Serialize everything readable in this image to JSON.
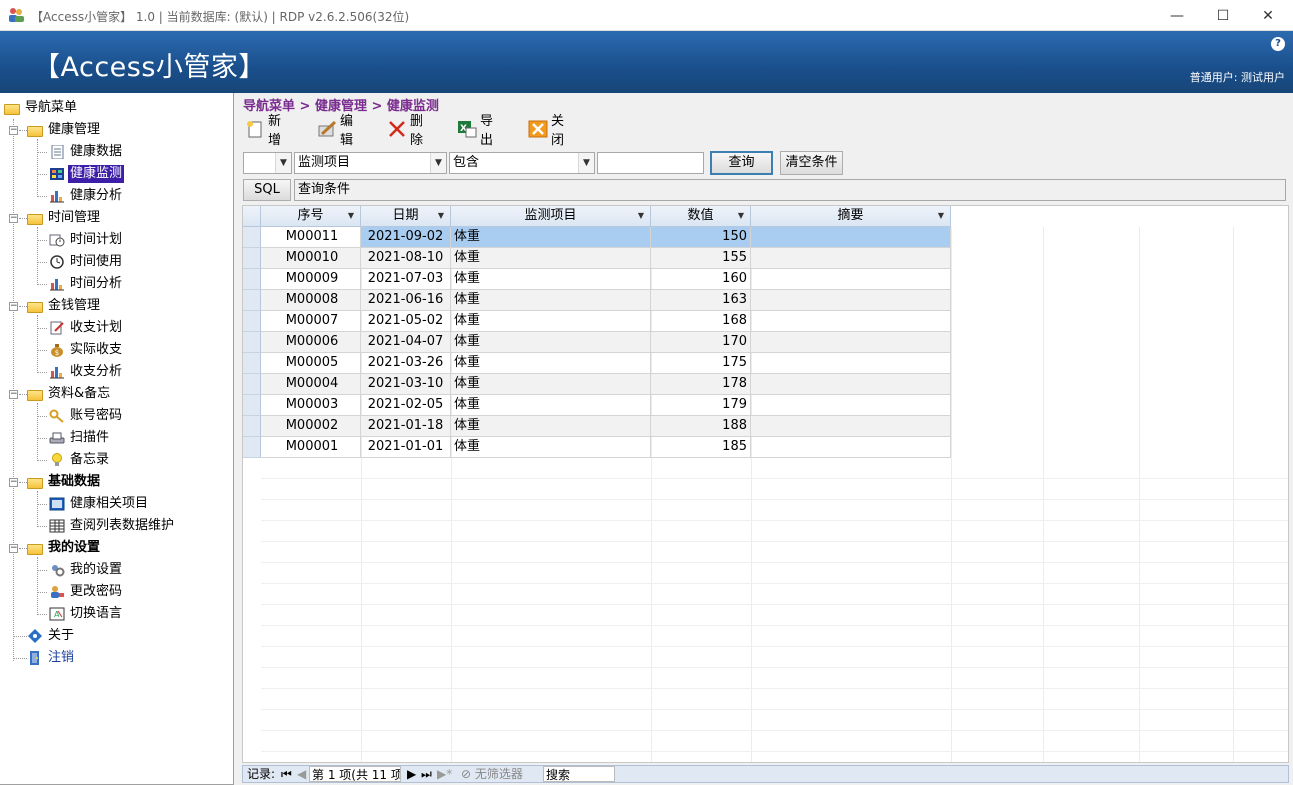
{
  "window": {
    "title": "【Access小管家】 1.0 | 当前数据库: (默认) | RDP v2.6.2.506(32位)",
    "minimize_glyph": "—",
    "maximize_glyph": "☐",
    "close_glyph": "✕"
  },
  "header": {
    "app_name": "【Access小管家】",
    "help_glyph": "?",
    "user_label": "普通用户: 测试用户"
  },
  "sidebar": {
    "root": "导航菜单",
    "groups": [
      {
        "label": "健康管理",
        "items": [
          "健康数据",
          "健康监测",
          "健康分析"
        ]
      },
      {
        "label": "时间管理",
        "items": [
          "时间计划",
          "时间使用",
          "时间分析"
        ]
      },
      {
        "label": "金钱管理",
        "items": [
          "收支计划",
          "实际收支",
          "收支分析"
        ]
      },
      {
        "label": "资料&备忘",
        "items": [
          "账号密码",
          "扫描件",
          "备忘录"
        ]
      },
      {
        "label": "基础数据",
        "items": [
          "健康相关项目",
          "查阅列表数据维护"
        ]
      },
      {
        "label": "我的设置",
        "items": [
          "我的设置",
          "更改密码",
          "切换语言"
        ]
      }
    ],
    "about": "关于",
    "logout": "注销",
    "selected": "健康监测"
  },
  "breadcrumb": "导航菜单 > 健康管理 > 健康监测",
  "toolbar": {
    "new_label": "新增",
    "edit_label": "编辑",
    "delete_label": "删除",
    "export_label": "导出",
    "close_label": "关闭"
  },
  "filter": {
    "prefix_value": "",
    "field_value": "监测项目",
    "operator_value": "包含",
    "text_value": "",
    "query_label": "查询",
    "clear_label": "清空条件",
    "sql_label": "SQL",
    "condition_text": "查询条件"
  },
  "grid": {
    "columns": [
      "序号",
      "日期",
      "监测项目",
      "数值",
      "摘要"
    ],
    "rows": [
      [
        "M00011",
        "2021-09-02",
        "体重",
        "150",
        ""
      ],
      [
        "M00010",
        "2021-08-10",
        "体重",
        "155",
        ""
      ],
      [
        "M00009",
        "2021-07-03",
        "体重",
        "160",
        ""
      ],
      [
        "M00008",
        "2021-06-16",
        "体重",
        "163",
        ""
      ],
      [
        "M00007",
        "2021-05-02",
        "体重",
        "168",
        ""
      ],
      [
        "M00006",
        "2021-04-07",
        "体重",
        "170",
        ""
      ],
      [
        "M00005",
        "2021-03-26",
        "体重",
        "175",
        ""
      ],
      [
        "M00004",
        "2021-03-10",
        "体重",
        "178",
        ""
      ],
      [
        "M00003",
        "2021-02-05",
        "体重",
        "179",
        ""
      ],
      [
        "M00002",
        "2021-01-18",
        "体重",
        "188",
        ""
      ],
      [
        "M00001",
        "2021-01-01",
        "体重",
        "185",
        ""
      ]
    ],
    "selected_row": 0,
    "selected_color": "#a9cdf0"
  },
  "navbar": {
    "records_label": "记录:",
    "position_text": "第 1 项(共 11 项",
    "no_filter_label": "无筛选器",
    "search_label": "搜索"
  },
  "colors": {
    "banner": "#1a4f8c",
    "breadcrumb": "#7a2c8f",
    "tree_selected": "#3d1ea8"
  }
}
